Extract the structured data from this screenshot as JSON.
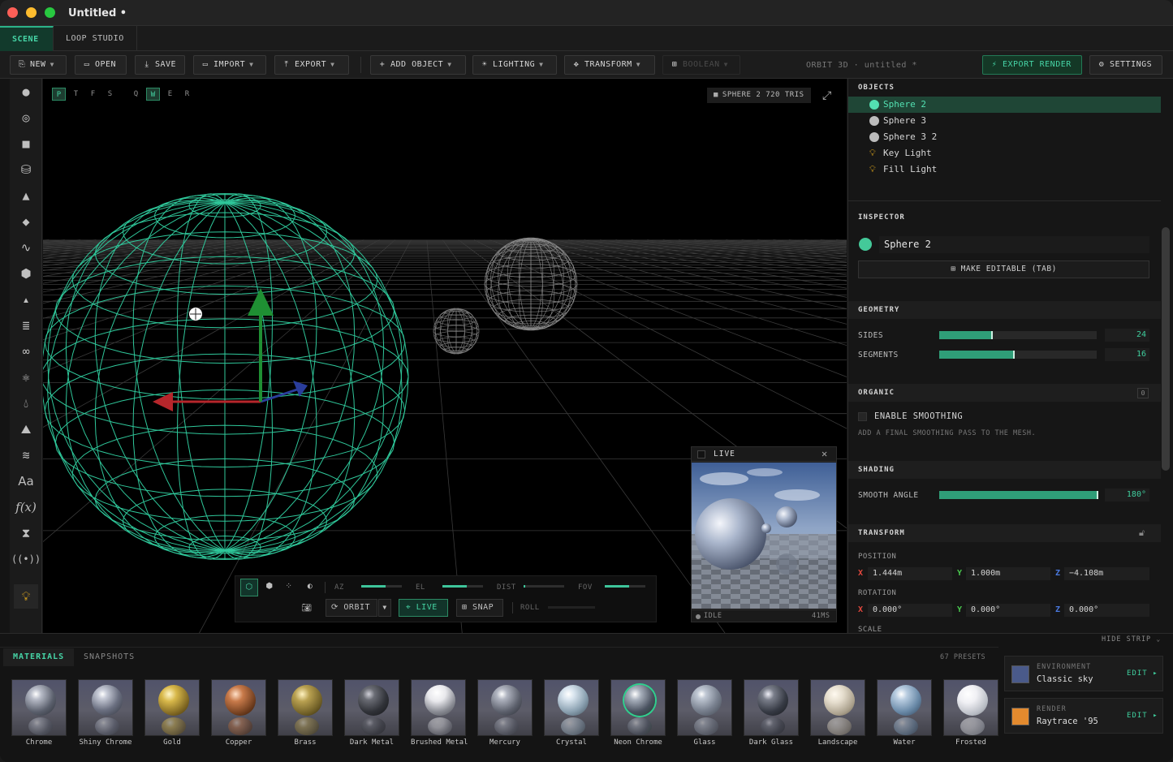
{
  "window": {
    "title": "Untitled •"
  },
  "tabs": [
    {
      "label": "SCENE",
      "active": true
    },
    {
      "label": "LOOP STUDIO",
      "active": false
    }
  ],
  "toolbar": {
    "new": "NEW",
    "open": "OPEN",
    "save": "SAVE",
    "import": "IMPORT",
    "export": "EXPORT",
    "add_object": "ADD OBJECT",
    "lighting": "LIGHTING",
    "transform": "TRANSFORM",
    "boolean": "BOOLEAN",
    "project": "ORBIT 3D · untitled *",
    "export_render": "EXPORT RENDER",
    "settings": "SETTINGS"
  },
  "viewport": {
    "view_buttons": [
      {
        "label": "P",
        "active": true
      },
      {
        "label": "T",
        "active": false
      },
      {
        "label": "F",
        "active": false
      },
      {
        "label": "S",
        "active": false
      },
      {
        "label": "Q",
        "active": false
      },
      {
        "label": "W",
        "active": true
      },
      {
        "label": "E",
        "active": false
      },
      {
        "label": "R",
        "active": false
      }
    ],
    "selection_info": "SPHERE 2 720 TRIS",
    "controls": {
      "az": "AZ",
      "el": "EL",
      "dist": "DIST",
      "fov": "FOV",
      "az_level": 0.6,
      "el_level": 0.6,
      "dist_level": 0.03,
      "fov_level": 0.6,
      "orbit": "ORBIT",
      "live": "LIVE",
      "snap": "SNAP",
      "roll": "ROLL"
    },
    "live_preview": {
      "title": "LIVE",
      "status": "IDLE",
      "time": "41MS"
    }
  },
  "objects": {
    "header": "OBJECTS",
    "items": [
      {
        "name": "Sphere 2",
        "type": "sphere",
        "selected": true
      },
      {
        "name": "Sphere 3",
        "type": "sphere",
        "selected": false
      },
      {
        "name": "Sphere 3 2",
        "type": "sphere",
        "selected": false
      },
      {
        "name": "Key Light",
        "type": "light",
        "selected": false
      },
      {
        "name": "Fill Light",
        "type": "light",
        "selected": false
      }
    ]
  },
  "inspector": {
    "header": "INSPECTOR",
    "name": "Sphere 2",
    "make_editable": "MAKE EDITABLE (TAB)",
    "geometry": {
      "header": "GEOMETRY",
      "sides_label": "SIDES",
      "sides": "24",
      "sides_level": 0.34,
      "segments_label": "SEGMENTS",
      "segments": "16",
      "segments_level": 0.48
    },
    "organic": {
      "header": "ORGANIC",
      "badge": "0",
      "smoothing_label": "ENABLE SMOOTHING",
      "smoothing_hint": "ADD A FINAL SMOOTHING PASS TO THE MESH."
    },
    "shading": {
      "header": "SHADING",
      "smooth_angle_label": "SMOOTH ANGLE",
      "smooth_angle": "180°",
      "smooth_angle_level": 1.0
    },
    "transform": {
      "header": "TRANSFORM",
      "position_label": "POSITION",
      "pos_x": "1.444m",
      "pos_y": "1.000m",
      "pos_z": "−4.108m",
      "rotation_label": "ROTATION",
      "rot_x": "0.000°",
      "rot_y": "0.000°",
      "rot_z": "0.000°",
      "scale_label": "SCALE"
    }
  },
  "strip": {
    "hide": "HIDE STRIP",
    "tabs": [
      {
        "label": "MATERIALS",
        "active": true
      },
      {
        "label": "SNAPSHOTS",
        "active": false
      }
    ],
    "presets_count": "67 PRESETS",
    "materials": [
      "Chrome",
      "Shiny Chrome",
      "Gold",
      "Copper",
      "Brass",
      "Dark Metal",
      "Brushed Metal",
      "Mercury",
      "Crystal",
      "Neon Chrome",
      "Glass",
      "Dark Glass",
      "Landscape",
      "Water",
      "Frosted"
    ],
    "environment": {
      "label": "ENVIRONMENT",
      "value": "Classic sky",
      "edit": "EDIT ▸",
      "color": "#4a5a8a"
    },
    "render": {
      "label": "RENDER",
      "value": "Raytrace '95",
      "edit": "EDIT ▸",
      "color": "#e38a2e"
    }
  },
  "colors": {
    "accent": "#46d4a6",
    "wire": "#2fc79a",
    "background": "#141414"
  }
}
